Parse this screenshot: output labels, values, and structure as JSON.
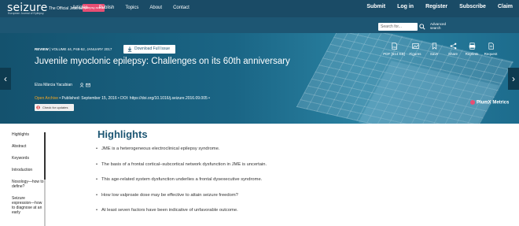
{
  "header": {
    "logo": "seizure",
    "logo_subtitle": "European Journal of Epilepsy",
    "journal_text": "The Official Journal of",
    "badge": "epilepsy action",
    "nav": [
      "Submit",
      "Log in",
      "Register",
      "Subscribe",
      "Claim"
    ]
  },
  "subnav": {
    "links": [
      "Articles",
      "Publish",
      "Topics",
      "About",
      "Contact"
    ],
    "search_placeholder": "Search for...",
    "advanced_search": "Advanced search"
  },
  "article": {
    "review_label": "REVIEW",
    "volume_info": "| VOLUME 44, P48-52, JANUARY 2017",
    "download_label": "Download Full Issue",
    "title": "Juvenile myoclonic epilepsy: Challenges on its 60th anniversary",
    "authors": "Elza Márcia Yacubian",
    "open_archive": "Open Archive",
    "published": "• Published: September 15, 2016 • DOI: https://doi.org/10.1016/j.seizure.2016.09.005 •",
    "check_updates": "Check for updates"
  },
  "tools": [
    {
      "label": "PDF [514 KB]",
      "icon": "pdf-icon"
    },
    {
      "label": "Figures",
      "icon": "figures-icon"
    },
    {
      "label": "Save",
      "icon": "save-icon"
    },
    {
      "label": "Share",
      "icon": "share-icon"
    },
    {
      "label": "Reprints",
      "icon": "reprints-icon"
    },
    {
      "label": "Request",
      "icon": "request-icon"
    }
  ],
  "plumx": "PlumX Metrics",
  "sidebar": {
    "items": [
      "Highlights",
      "Abstract",
      "Keywords",
      "Introduction",
      "Nosology—how to define?",
      "Seizure expression—how to diagnose at an early"
    ]
  },
  "highlights": {
    "title": "Highlights",
    "items": [
      "JME is a heterogeneous electroclinical epilepsy syndrome.",
      "The basis of a frontal cortical–subcortical network dysfunction in JME is uncertain.",
      "This age-related system dysfunction underlies a frontal dysexecutive syndrome.",
      "How low valproate dose may be effective to attain seizure freedom?",
      "At least seven factors have been indicative of unfavorable outcome."
    ]
  },
  "colors": {
    "header": "#1a4b66",
    "hero": "#1d6c8d",
    "accent_orange": "#f5a623",
    "highlight_title": "#1d5673"
  }
}
